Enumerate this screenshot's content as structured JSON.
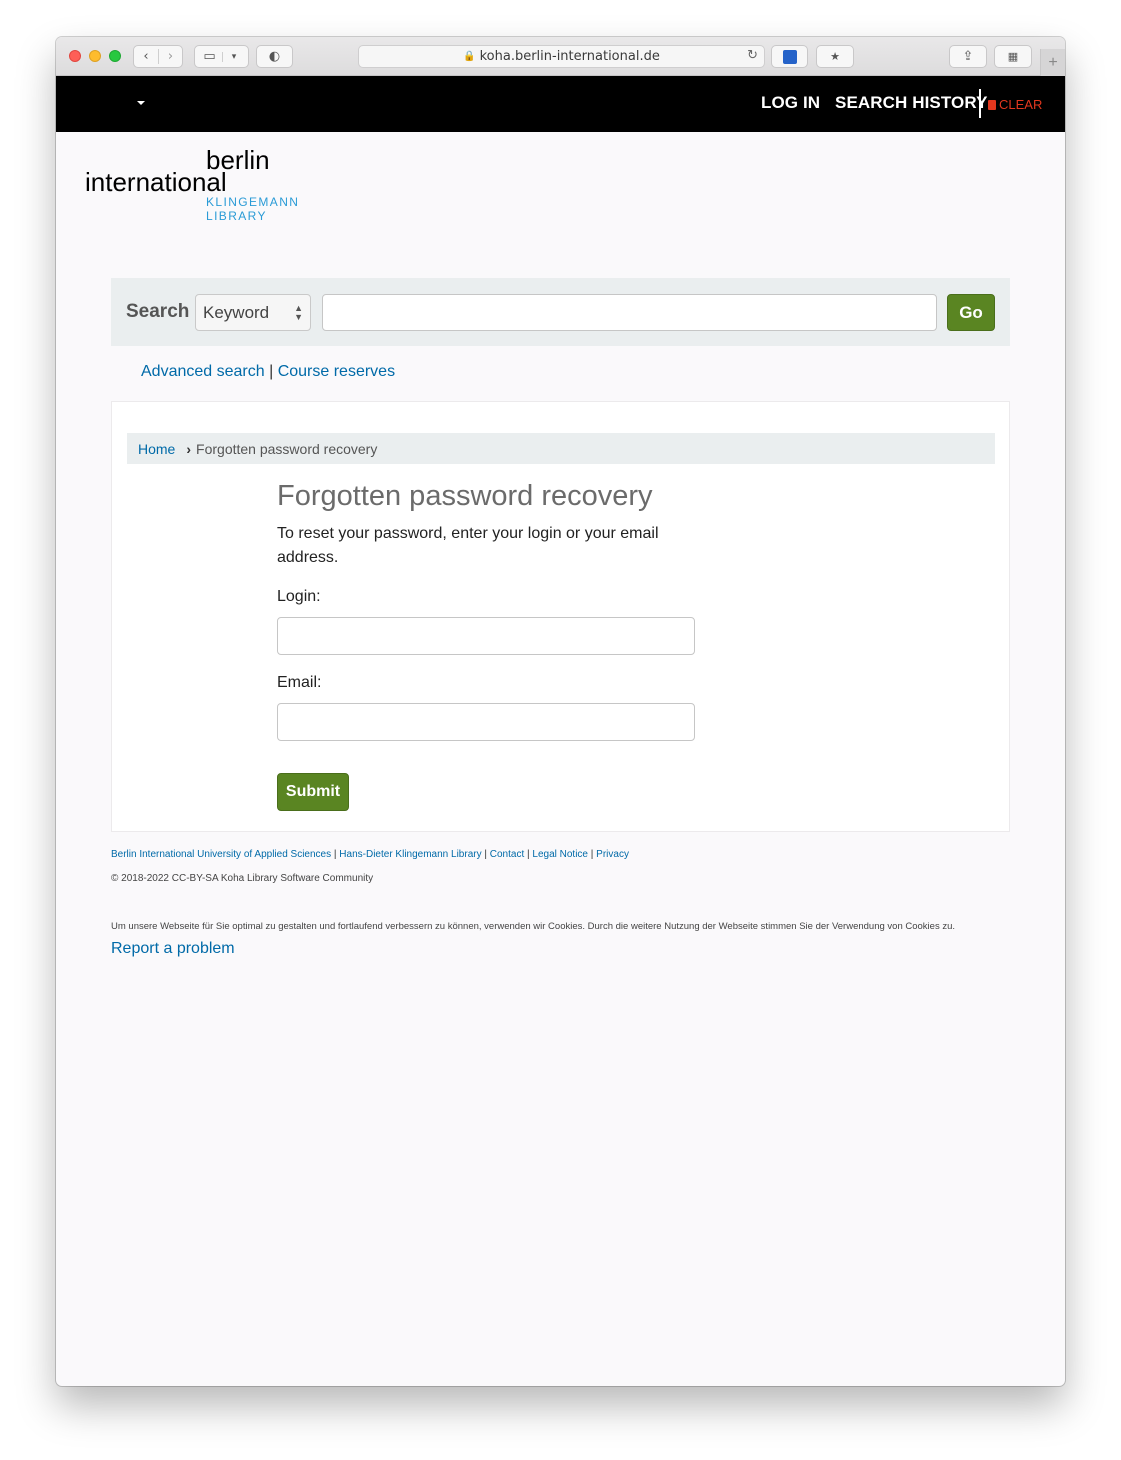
{
  "browser": {
    "url": "koha.berlin-international.de"
  },
  "nav": {
    "login": "LOG IN",
    "search_history": "SEARCH HISTORY",
    "clear": "CLEAR"
  },
  "logo": {
    "berlin": "berlin",
    "international": "international",
    "klingemann": "KLINGEMANN",
    "library": "LIBRARY"
  },
  "search": {
    "label": "Search",
    "selected_option": "Keyword",
    "query": "",
    "go_label": "Go"
  },
  "sublinks": {
    "advanced": "Advanced search",
    "separator": "|",
    "course": "Course reserves"
  },
  "breadcrumb": {
    "home": "Home",
    "separator": "›",
    "current": "Forgotten password recovery"
  },
  "form": {
    "title": "Forgotten password recovery",
    "intro": "To reset your password, enter your login or your email address.",
    "login_label": "Login:",
    "login_value": "",
    "email_label": "Email:",
    "email_value": "",
    "submit_label": "Submit"
  },
  "footer": {
    "links": [
      "Berlin International University of Applied Sciences",
      "Hans-Dieter Klingemann Library",
      "Contact",
      "Legal Notice",
      "Privacy"
    ],
    "separator": "|",
    "copyright": "© 2018-2022 CC-BY-SA Koha Library Software Community",
    "cookie_notice": "Um unsere Webseite für Sie optimal zu gestalten und fortlaufend verbessern zu können, verwenden wir Cookies. Durch die weitere Nutzung der Webseite stimmen Sie der Verwendung von Cookies zu.",
    "report": "Report a problem"
  },
  "colors": {
    "nav_bg": "#000000",
    "link": "#006aa8",
    "button_green": "#5a8522",
    "clear_red": "#e2371e",
    "logo_blue": "#2a9bd6"
  }
}
